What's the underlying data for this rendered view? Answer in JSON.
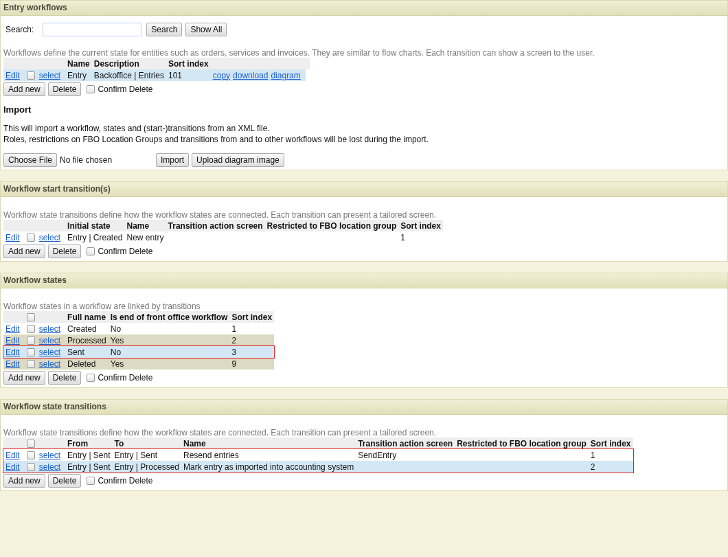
{
  "sections": [
    {
      "title": "Entry workflows",
      "search": {
        "label": "Search:",
        "buttons": [
          "Search",
          "Show All"
        ]
      },
      "description": "Workflows define the current state for entities such as orders, services and invoices. They are similar to flow charts. Each transition can show a screen to the user.",
      "table": {
        "columns": [
          "Name",
          "Description",
          "Sort index",
          "",
          ""
        ],
        "rows": [
          {
            "edit": "Edit",
            "checked": false,
            "select": "select",
            "cells": [
              "Entry",
              "Backoffice | Entries",
              "101"
            ],
            "links": [
              "copy",
              "download",
              "diagram"
            ],
            "kind": "selected",
            "outlined": false
          }
        ]
      },
      "actions": {
        "add": "Add new",
        "delete": "Delete",
        "confirm": "Confirm Delete",
        "confirm_checked": false
      },
      "import": {
        "heading": "Import",
        "lines": [
          "This will import a workflow, states and (start-)transitions from an XML file.",
          "Roles, restrictions on FBO Location Groups and transitions from and to other workflows will be lost during the import."
        ],
        "choose": "Choose File",
        "file_status": "No file chosen",
        "buttons": [
          "Import",
          "Upload diagram image"
        ]
      }
    },
    {
      "title": "Workflow start transition(s)",
      "description": "Workflow state transitions define how the workflow states are connected. Each transition can present a tailored screen.",
      "table": {
        "columns": [
          "Initial state",
          "Name",
          "Transition action screen",
          "Restricted to FBO location group",
          "Sort index"
        ],
        "rows": [
          {
            "edit": "Edit",
            "checked": false,
            "select": "select",
            "cells": [
              "Entry | Created",
              "New entry",
              "",
              "",
              "1"
            ],
            "kind": "plain",
            "outlined": false
          }
        ]
      },
      "actions": {
        "add": "Add new",
        "delete": "Delete",
        "confirm": "Confirm Delete",
        "confirm_checked": false
      }
    },
    {
      "title": "Workflow states",
      "description": "Workflow states in a workflow are linked by transitions",
      "table": {
        "header_checkbox": {
          "checked": false
        },
        "columns": [
          "Full name",
          "Is end of front office workflow",
          "Sort index"
        ],
        "rows": [
          {
            "edit": "Edit",
            "checked": false,
            "select": "select",
            "cells": [
              "Created",
              "No",
              "1"
            ],
            "kind": "plain",
            "outlined": false
          },
          {
            "edit": "Edit",
            "checked": false,
            "select": "select",
            "cells": [
              "Processed",
              "Yes",
              "2"
            ],
            "kind": "alternate",
            "outlined": false
          },
          {
            "edit": "Edit",
            "checked": false,
            "select": "select",
            "cells": [
              "Sent",
              "No",
              "3"
            ],
            "kind": "selected",
            "outlined": true
          },
          {
            "edit": "Edit",
            "checked": false,
            "select": "select",
            "cells": [
              "Deleted",
              "Yes",
              "9"
            ],
            "kind": "alternate",
            "outlined": false
          }
        ]
      },
      "actions": {
        "add": "Add new",
        "delete": "Delete",
        "confirm": "Confirm Delete",
        "confirm_checked": false
      }
    },
    {
      "title": "Workflow state transitions",
      "description": "Workflow state transitions define how the workflow states are connected. Each transition can present a tailored screen.",
      "table": {
        "header_checkbox": {
          "checked": false
        },
        "columns": [
          "From",
          "To",
          "Name",
          "Transition action screen",
          "Restricted to FBO location group",
          "Sort index"
        ],
        "rows": [
          {
            "edit": "Edit",
            "checked": false,
            "select": "select",
            "cells": [
              "Entry | Sent",
              "Entry | Sent",
              "Resend entries",
              "SendEntry",
              "",
              "1"
            ],
            "kind": "plain",
            "outlined": true
          },
          {
            "edit": "Edit",
            "checked": false,
            "select": "select",
            "cells": [
              "Entry | Sent",
              "Entry | Processed",
              "Mark entry as imported into accounting system",
              "",
              "",
              "2"
            ],
            "kind": "selected",
            "outlined": true
          }
        ]
      },
      "actions": {
        "add": "Add new",
        "delete": "Delete",
        "confirm": "Confirm Delete",
        "confirm_checked": false
      }
    }
  ]
}
